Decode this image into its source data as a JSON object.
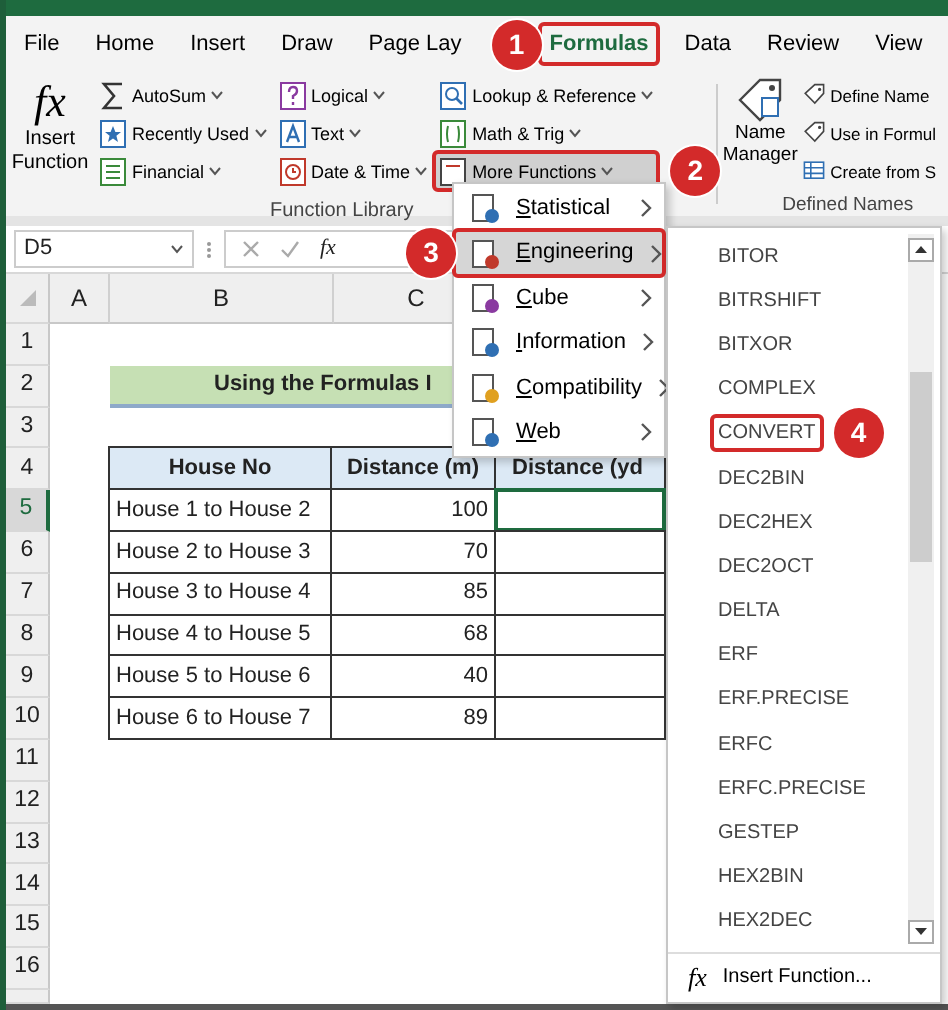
{
  "tabs": [
    {
      "label": "File",
      "selected": false,
      "outlined": false
    },
    {
      "label": "Home",
      "selected": false,
      "outlined": false
    },
    {
      "label": "Insert",
      "selected": false,
      "outlined": false
    },
    {
      "label": "Draw",
      "selected": false,
      "outlined": false
    },
    {
      "label": "Page Lay",
      "selected": false,
      "outlined": false
    },
    {
      "label": "Formulas",
      "selected": true,
      "outlined": true
    },
    {
      "label": "Data",
      "selected": false,
      "outlined": false
    },
    {
      "label": "Review",
      "selected": false,
      "outlined": false
    },
    {
      "label": "View",
      "selected": false,
      "outlined": false
    }
  ],
  "ribbon": {
    "insert_function": {
      "icon_text": "fx",
      "label_lines": [
        "Insert",
        "Function"
      ]
    },
    "function_columns": [
      [
        {
          "label": "AutoSum",
          "pressed": false,
          "outlined": false
        },
        {
          "label": "Recently Used",
          "pressed": false,
          "outlined": false
        },
        {
          "label": "Financial",
          "pressed": false,
          "outlined": false
        }
      ],
      [
        {
          "label": "Logical",
          "pressed": false,
          "outlined": false
        },
        {
          "label": "Text",
          "pressed": false,
          "outlined": false
        },
        {
          "label": "Date & Time",
          "pressed": false,
          "outlined": false
        }
      ],
      [
        {
          "label": "Lookup & Reference",
          "pressed": false,
          "outlined": false
        },
        {
          "label": "Math & Trig",
          "pressed": false,
          "outlined": false
        },
        {
          "label": "More Functions",
          "pressed": true,
          "outlined": true
        }
      ]
    ],
    "function_library_label": "Function Library",
    "name_manager_lines": [
      "Name",
      "Manager"
    ],
    "defined_names": [
      {
        "label": "Define Name"
      },
      {
        "label": "Use in Formul"
      },
      {
        "label": "Create from S"
      }
    ],
    "defined_names_label": "Defined Names"
  },
  "formula_bar": {
    "name_box": "D5",
    "fx": "fx"
  },
  "sheet": {
    "columns": [
      "A",
      "B",
      "C"
    ],
    "row_headers": [
      {
        "label": "1",
        "selected": false
      },
      {
        "label": "2",
        "selected": false
      },
      {
        "label": "3",
        "selected": false
      },
      {
        "label": "4",
        "selected": false
      },
      {
        "label": "5",
        "selected": true
      },
      {
        "label": "6",
        "selected": false
      },
      {
        "label": "7",
        "selected": false
      },
      {
        "label": "8",
        "selected": false
      },
      {
        "label": "9",
        "selected": false
      },
      {
        "label": "10",
        "selected": false
      },
      {
        "label": "11",
        "selected": false
      },
      {
        "label": "12",
        "selected": false
      },
      {
        "label": "13",
        "selected": false
      },
      {
        "label": "14",
        "selected": false
      },
      {
        "label": "15",
        "selected": false
      },
      {
        "label": "16",
        "selected": false
      }
    ],
    "title": "Using the Formulas I",
    "table": {
      "columns": [
        "House No",
        "Distance (m)",
        "Distance (yd"
      ],
      "rows": [
        {
          "cells": [
            "House 1 to House 2",
            "100"
          ],
          "selected": true
        },
        {
          "cells": [
            "House 2 to House 3",
            "70"
          ],
          "selected": false
        },
        {
          "cells": [
            "House 3 to House 4",
            "85"
          ],
          "selected": false
        },
        {
          "cells": [
            "House 4 to House 5",
            "68"
          ],
          "selected": false
        },
        {
          "cells": [
            "House 5 to House 6",
            "40"
          ],
          "selected": false
        },
        {
          "cells": [
            "House 6 to House 7",
            "89"
          ],
          "selected": false
        }
      ]
    }
  },
  "category_menu": [
    {
      "label": "Statistical",
      "selected": false,
      "outlined": false
    },
    {
      "label": "Engineering",
      "selected": true,
      "outlined": true
    },
    {
      "label": "Cube",
      "selected": false,
      "outlined": false
    },
    {
      "label": "Information",
      "selected": false,
      "outlined": false
    },
    {
      "label": "Compatibility",
      "selected": false,
      "outlined": false
    },
    {
      "label": "Web",
      "selected": false,
      "outlined": false
    }
  ],
  "engineering_menu": {
    "items": [
      {
        "label": "BITOR",
        "outlined": false
      },
      {
        "label": "BITRSHIFT",
        "outlined": false
      },
      {
        "label": "BITXOR",
        "outlined": false
      },
      {
        "label": "COMPLEX",
        "outlined": false
      },
      {
        "label": "CONVERT",
        "outlined": true
      },
      {
        "label": "DEC2BIN",
        "outlined": false
      },
      {
        "label": "DEC2HEX",
        "outlined": false
      },
      {
        "label": "DEC2OCT",
        "outlined": false
      },
      {
        "label": "DELTA",
        "outlined": false
      },
      {
        "label": "ERF",
        "outlined": false
      },
      {
        "label": "ERF.PRECISE",
        "outlined": false
      },
      {
        "label": "ERFC",
        "outlined": false
      },
      {
        "label": "ERFC.PRECISE",
        "outlined": false
      },
      {
        "label": "GESTEP",
        "outlined": false
      },
      {
        "label": "HEX2BIN",
        "outlined": false
      },
      {
        "label": "HEX2DEC",
        "outlined": false
      }
    ],
    "footer_icon_text": "fx",
    "footer": "Insert Function..."
  },
  "callouts": [
    "1",
    "2",
    "3",
    "4"
  ]
}
